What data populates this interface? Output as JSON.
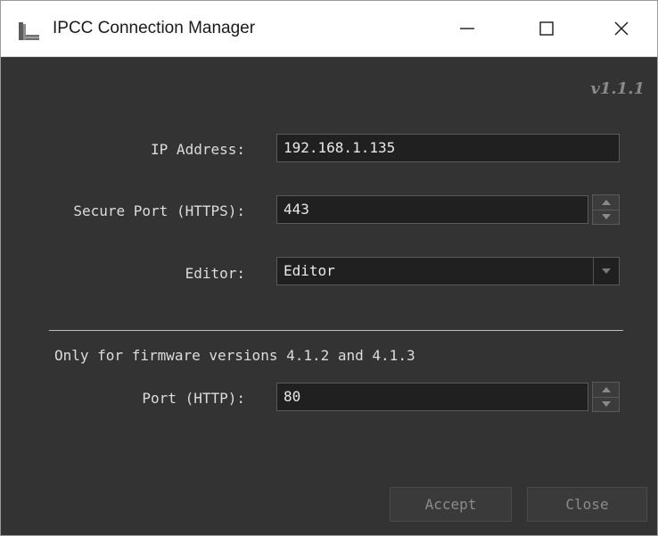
{
  "window": {
    "title": "IPCC Connection Manager",
    "icon": "app-icon"
  },
  "version": "v1.1.1",
  "form": {
    "ip_label": "IP Address:",
    "ip_value": "192.168.1.135",
    "secure_port_label": "Secure Port (HTTPS):",
    "secure_port_value": "443",
    "editor_label": "Editor:",
    "editor_value": "Editor",
    "firmware_note": "Only for firmware versions 4.1.2 and 4.1.3",
    "http_port_label": "Port (HTTP):",
    "http_port_value": "80"
  },
  "buttons": {
    "accept": "Accept",
    "close": "Close"
  },
  "colors": {
    "background": "#333333",
    "field_background": "#202020",
    "text": "#dcdcdc",
    "disabled_text": "#8b8b8b"
  }
}
